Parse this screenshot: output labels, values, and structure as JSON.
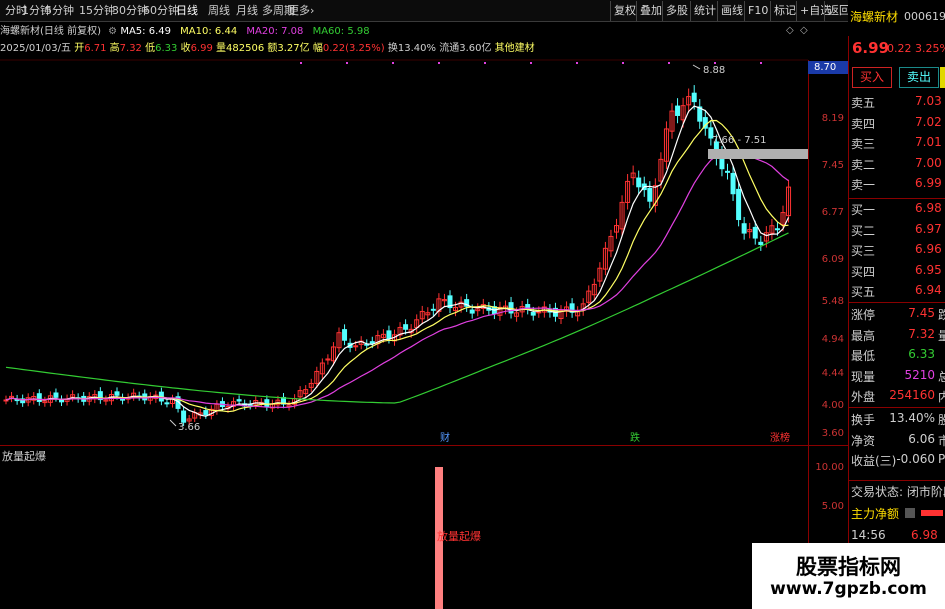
{
  "toolbar": {
    "periods": [
      "分时",
      "1分钟",
      "5分钟",
      "15分钟",
      "30分钟",
      "60分钟",
      "日线",
      "周线",
      "月线",
      "多周期",
      "更多›"
    ],
    "selected": "日线",
    "right": [
      "复权",
      "叠加",
      "多股",
      "统计",
      "画线",
      "F10",
      "标记",
      "+自选",
      "返回"
    ]
  },
  "ticker": {
    "name": "海螺新材",
    "code": "000619"
  },
  "chart_header": {
    "title": "海螺新材(日线 前复权)",
    "ma5": "MA5: 6.49",
    "ma10": "MA10: 6.44",
    "ma20": "MA20: 7.08",
    "ma60": "MA60: 5.98"
  },
  "info_line": {
    "date": "2025/01/03/五",
    "open_label": "开",
    "open": "6.71",
    "high_label": "高",
    "high": "7.32",
    "low_label": "低",
    "low": "6.33",
    "close_label": "收",
    "close": "6.99",
    "vol_label": "量",
    "vol": "482506",
    "amt_label": "额",
    "amt": "3.27亿",
    "chg_label": "幅",
    "chg": "0.22(3.25%)",
    "turn": "换13.40%",
    "float": "流通3.60亿",
    "sector": "其他建材"
  },
  "y_axis": [
    "8.19",
    "7.45",
    "6.77",
    "6.09",
    "5.48",
    "4.94",
    "4.44",
    "4.00",
    "3.60"
  ],
  "price_tag": "8.70",
  "annotations": {
    "high": "8.88",
    "range": "7.66 - 7.51",
    "low": "3.66"
  },
  "markers": [
    "财",
    "跌",
    "涨榜"
  ],
  "indicator": {
    "name": "放量起爆",
    "bar_label": "放量起爆",
    "axis": [
      "10.00",
      "5.00"
    ]
  },
  "colors": {
    "up": "#ff3232",
    "down": "#54ffff",
    "ma5": "#ffffff",
    "ma10": "#ffff64",
    "ma20": "#e040e0",
    "ma60": "#33cc33",
    "pink": "#ff8080"
  },
  "quote": {
    "price": "6.99",
    "change": "0.22",
    "pct": "3.25%",
    "buy_btn": "买入",
    "sell_btn": "卖出",
    "asks": [
      {
        "label": "卖五",
        "price": "7.03"
      },
      {
        "label": "卖四",
        "price": "7.02"
      },
      {
        "label": "卖三",
        "price": "7.01"
      },
      {
        "label": "卖二",
        "price": "7.00"
      },
      {
        "label": "卖一",
        "price": "6.99"
      }
    ],
    "bids": [
      {
        "label": "买一",
        "price": "6.98"
      },
      {
        "label": "买二",
        "price": "6.97"
      },
      {
        "label": "买三",
        "price": "6.96"
      },
      {
        "label": "买四",
        "price": "6.95"
      },
      {
        "label": "买五",
        "price": "6.94"
      }
    ],
    "stats": [
      {
        "label": "涨停",
        "value": "7.45",
        "tail": "跌"
      },
      {
        "label": "最高",
        "value": "7.32",
        "tail": "量"
      },
      {
        "label": "最低",
        "value": "6.33",
        "tail": ""
      },
      {
        "label": "现量",
        "value": "5210",
        "tail": "总"
      },
      {
        "label": "外盘",
        "value": "254160",
        "tail": "内"
      }
    ],
    "stats2": [
      {
        "label": "换手",
        "value": "13.40%",
        "tail": "股"
      },
      {
        "label": "净资",
        "value": "6.06",
        "tail": "市"
      },
      {
        "label": "收益(三)",
        "value": "-0.060",
        "tail": "P"
      }
    ],
    "status": "交易状态: 闭市阶段",
    "main_net": "主力净额",
    "time": "14:56",
    "last": "6.98"
  },
  "watermark": {
    "line1": "股票指标网",
    "line2": "www.7gpzb.com"
  }
}
